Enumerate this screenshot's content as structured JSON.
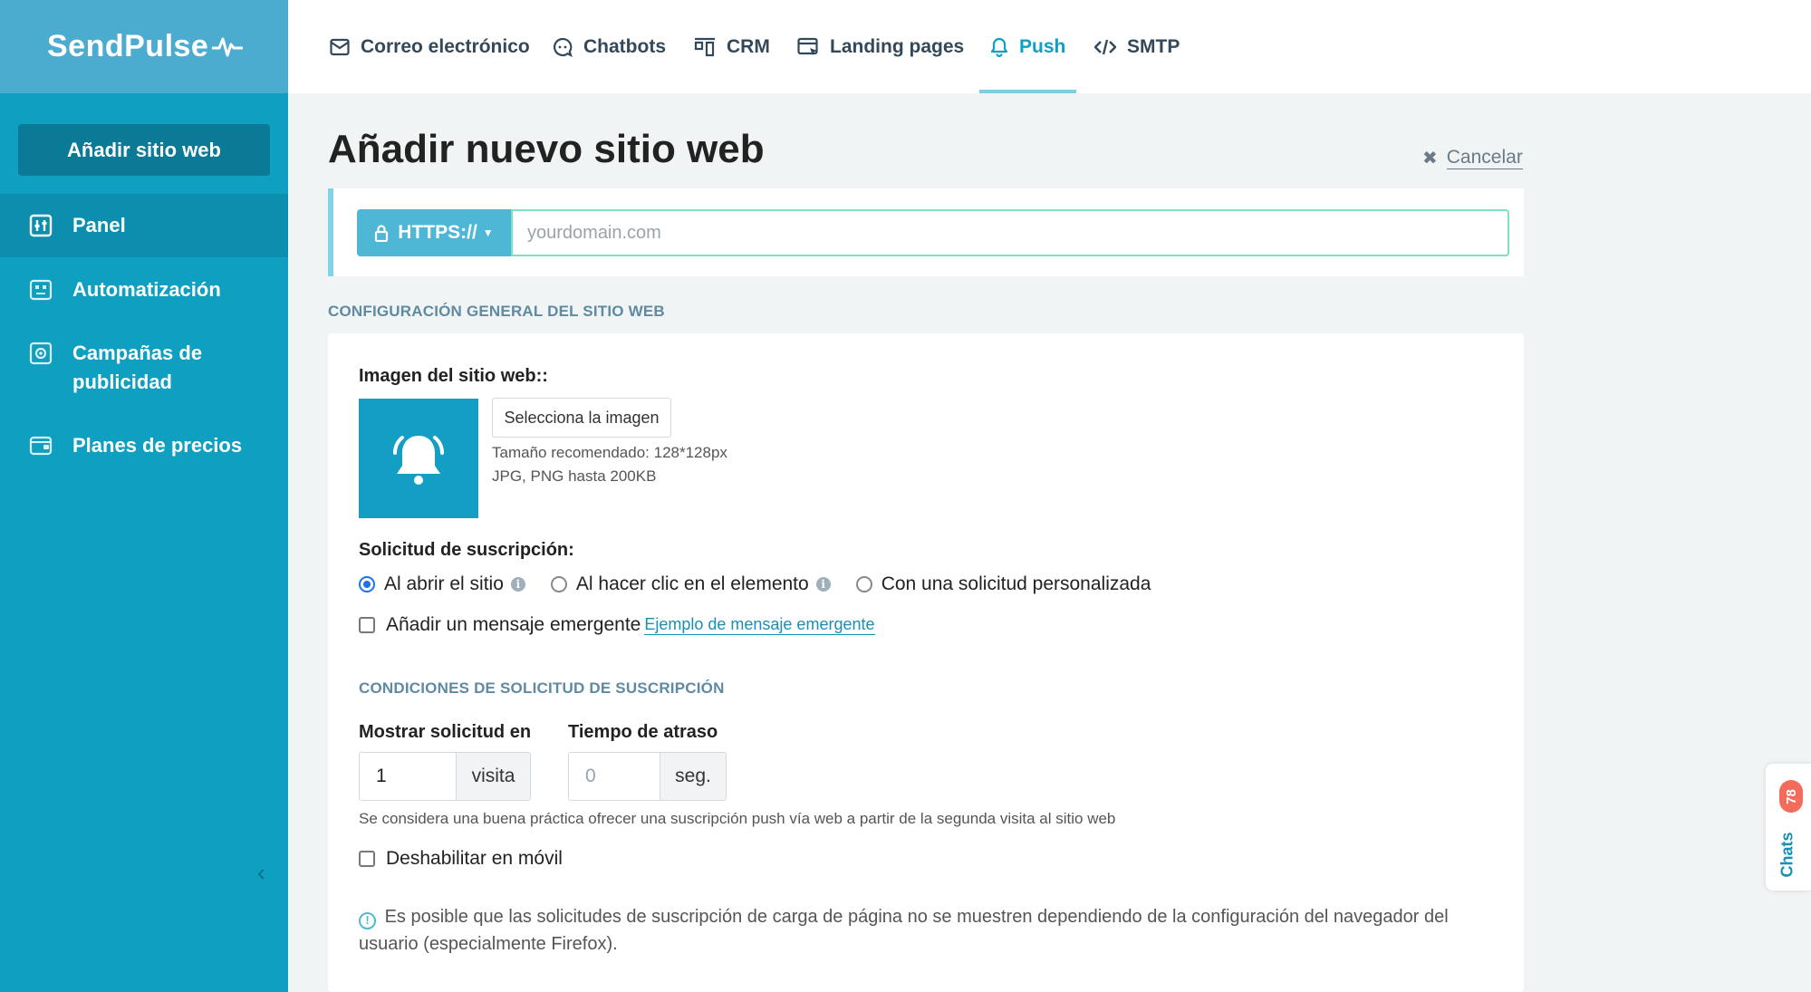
{
  "app": {
    "brand": "SendPulse"
  },
  "sidebar": {
    "add_site_label": "Añadir sitio web",
    "items": [
      {
        "label": "Panel",
        "icon": "dashboard-icon"
      },
      {
        "label": "Automatización",
        "icon": "automation-icon"
      },
      {
        "label": "Campañas de publicidad",
        "icon": "campaigns-icon"
      },
      {
        "label": "Planes de precios",
        "icon": "wallet-icon"
      }
    ]
  },
  "topnav": {
    "items": [
      {
        "label": "Correo electrónico",
        "icon": "mail-icon"
      },
      {
        "label": "Chatbots",
        "icon": "chatbot-icon"
      },
      {
        "label": "CRM",
        "icon": "crm-icon"
      },
      {
        "label": "Landing pages",
        "icon": "landing-icon"
      },
      {
        "label": "Push",
        "icon": "bell-icon",
        "active": true
      },
      {
        "label": "SMTP",
        "icon": "code-icon"
      }
    ]
  },
  "page": {
    "title": "Añadir nuevo sitio web",
    "cancel_label": "Cancelar"
  },
  "url": {
    "protocol": "HTTPS://",
    "placeholder": "yourdomain.com",
    "value": ""
  },
  "general": {
    "section_title": "CONFIGURACIÓN GENERAL DEL SITIO WEB",
    "image_label": "Imagen del sitio web::",
    "select_image_label": "Selecciona la imagen",
    "recommended_size": "Tamaño recomendado: 128*128px",
    "formats": "JPG, PNG hasta 200KB"
  },
  "subscription": {
    "label": "Solicitud de suscripción:",
    "options": [
      {
        "label": "Al abrir el sitio",
        "selected": true
      },
      {
        "label": "Al hacer clic en el elemento",
        "selected": false
      },
      {
        "label": "Con una solicitud personalizada",
        "selected": false
      }
    ],
    "popup_checkbox_label": "Añadir un mensaje emergente",
    "popup_example_link": "Ejemplo de mensaje emergente"
  },
  "conditions": {
    "section_title": "CONDICIONES DE SOLICITUD DE SUSCRIPCIÓN",
    "show_label": "Mostrar solicitud en",
    "show_value": "1",
    "show_unit": "visita",
    "delay_label": "Tiempo de atraso",
    "delay_placeholder": "0",
    "delay_unit": "seg.",
    "best_practice": "Se considera una buena práctica ofrecer una suscripción push vía web a partir de la segunda visita al sitio web",
    "mobile_checkbox_label": "Deshabilitar en móvil",
    "note": "Es posible que las solicitudes de suscripción de carga de página no se muestren dependiendo de la configuración del navegador del usuario (especialmente Firefox)."
  },
  "chats": {
    "label": "Chats",
    "count": "78"
  },
  "colors": {
    "sidebar": "#0f9fc0",
    "accent": "#0e9fc4",
    "badge": "#f26b5b"
  }
}
